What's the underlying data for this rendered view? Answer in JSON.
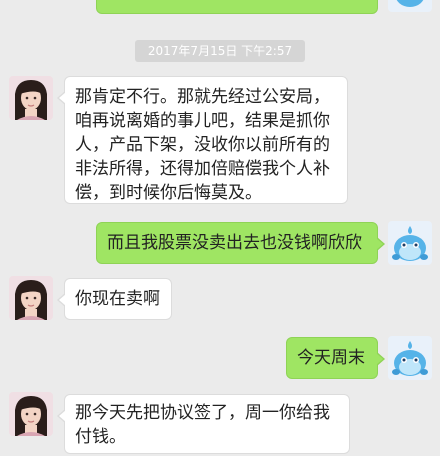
{
  "chat": {
    "timestamp": "2017年7月15日 下午2:57",
    "messages": [
      {
        "sender": "contact",
        "lines": [
          "那肯定不行。那就先经过公安局，",
          "咱再说离婚的事儿吧，结果是抓你",
          "人，产品下架，没收你以前所有的",
          "非法所得，还得加倍赔偿我个人补",
          "偿，到时候你后悔莫及。"
        ]
      },
      {
        "sender": "me",
        "lines": [
          "而且我股票没卖出去也没钱啊欣欣"
        ]
      },
      {
        "sender": "contact",
        "lines": [
          "你现在卖啊"
        ]
      },
      {
        "sender": "me",
        "lines": [
          "今天周末"
        ]
      },
      {
        "sender": "contact",
        "lines": [
          "那今天先把协议签了，周一你给我",
          "付钱。"
        ]
      }
    ]
  },
  "avatars": {
    "contact_icon": "girl-avatar-icon",
    "me_icon": "blue-mascot-avatar-icon"
  },
  "colors": {
    "background": "#ebebeb",
    "incoming_bubble": "#ffffff",
    "outgoing_bubble": "#9fe563",
    "timestamp_pill": "#d5d5d5"
  }
}
